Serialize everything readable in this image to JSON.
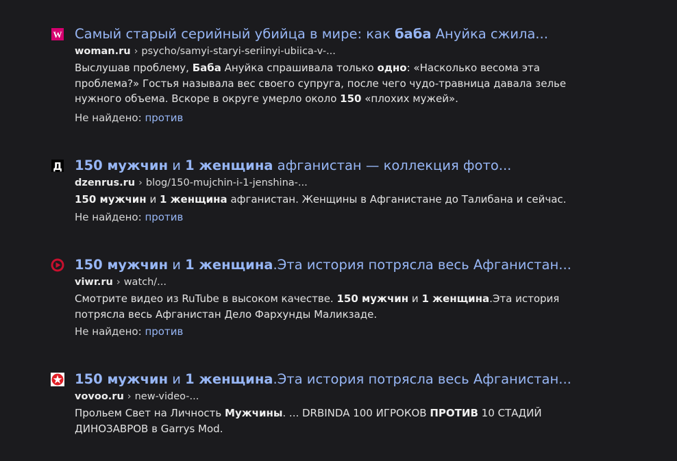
{
  "results": [
    {
      "favicon": "woman-ru-w-icon",
      "title_parts": [
        {
          "text": "Самый старый серийный убийца в мире: как ",
          "bold": false
        },
        {
          "text": "баба",
          "bold": true
        },
        {
          "text": " Ануйка сжила...",
          "bold": false
        }
      ],
      "domain": "woman.ru",
      "separator": "›",
      "path": "psycho/samyi-staryi-seriinyi-ubiica-v-...",
      "snippet_parts": [
        {
          "text": "Выслушав проблему, ",
          "bold": false
        },
        {
          "text": "Баба",
          "bold": true
        },
        {
          "text": " Ануйка спрашивала только ",
          "bold": false
        },
        {
          "text": "одно",
          "bold": true
        },
        {
          "text": ": «Насколько весома эта проблема?» Гостья называла вес своего супруга, после чего чудо-травница давала зелье нужного объема. Вскоре в округе умерло около ",
          "bold": false
        },
        {
          "text": "150",
          "bold": true
        },
        {
          "text": " «плохих мужей».",
          "bold": false
        }
      ],
      "missing_label": "Не найдено:",
      "missing_word": "против"
    },
    {
      "favicon": "dzenrus-d-icon",
      "title_parts": [
        {
          "text": "150 мужчин",
          "bold": true
        },
        {
          "text": " и ",
          "bold": false
        },
        {
          "text": "1 женщина",
          "bold": true
        },
        {
          "text": " афганистан — коллекция фото...",
          "bold": false
        }
      ],
      "domain": "dzenrus.ru",
      "separator": "›",
      "path": "blog/150-mujchin-i-1-jenshina-...",
      "snippet_parts": [
        {
          "text": "150 мужчин",
          "bold": true
        },
        {
          "text": " и ",
          "bold": false
        },
        {
          "text": "1 женщина",
          "bold": true
        },
        {
          "text": " афганистан. Женщины в Афганистане до Талибана и сейчас.",
          "bold": false
        }
      ],
      "missing_label": "Не найдено:",
      "missing_word": "против"
    },
    {
      "favicon": "viwr-play-icon",
      "title_parts": [
        {
          "text": "150 мужчин",
          "bold": true
        },
        {
          "text": " и ",
          "bold": false
        },
        {
          "text": "1 женщина",
          "bold": true
        },
        {
          "text": ".Эта история потрясла весь Афганистан...",
          "bold": false
        }
      ],
      "domain": "viwr.ru",
      "separator": "›",
      "path": "watch/...",
      "snippet_parts": [
        {
          "text": "Смотрите видео из RuTube в высоком качестве. ",
          "bold": false
        },
        {
          "text": "150 мужчин",
          "bold": true
        },
        {
          "text": " и ",
          "bold": false
        },
        {
          "text": "1 женщина",
          "bold": true
        },
        {
          "text": ".Эта история потрясла весь Афганистан Дело Фархунды Маликзаде.",
          "bold": false
        }
      ],
      "missing_label": "Не найдено:",
      "missing_word": "против"
    },
    {
      "favicon": "vovoo-star-icon",
      "title_parts": [
        {
          "text": "150 мужчин",
          "bold": true
        },
        {
          "text": " и ",
          "bold": false
        },
        {
          "text": "1 женщина",
          "bold": true
        },
        {
          "text": ".Эта история потрясла весь Афганистан...",
          "bold": false
        }
      ],
      "domain": "vovoo.ru",
      "separator": "›",
      "path": "new-video-...",
      "snippet_parts": [
        {
          "text": "Прольем Свет на Личность ",
          "bold": false
        },
        {
          "text": "Мужчины",
          "bold": true
        },
        {
          "text": ". ... DRBINDA 100 ИГРОКОВ ",
          "bold": false
        },
        {
          "text": "ПРОТИВ",
          "bold": true
        },
        {
          "text": " 10 СТАДИЙ ДИНОЗАВРОВ в Garrys Mod.",
          "bold": false
        }
      ]
    }
  ],
  "colors": {
    "background": "#1b1b1e",
    "link": "#97b6f5",
    "text": "#e3e3e3",
    "woman_ru_brand": "#d6006f",
    "viwr_brand": "#c8102e",
    "vovoo_brand": "#e01f26"
  }
}
